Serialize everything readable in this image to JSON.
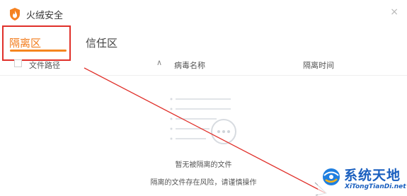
{
  "app": {
    "title": "火绒安全",
    "close_glyph": "×"
  },
  "tabs": [
    {
      "label": "隔离区",
      "active": true
    },
    {
      "label": "信任区",
      "active": false
    }
  ],
  "table": {
    "columns": {
      "path": "文件路径",
      "virus_name": "病毒名称",
      "time": "隔离时间"
    },
    "sort_glyph": "∧"
  },
  "empty_state": {
    "title": "暂无被隔离的文件",
    "hint": "隔离的文件存在风险，请谨慎操作"
  },
  "watermark": {
    "cn": "系统天地",
    "en": "XiTongTianDi.net"
  },
  "colors": {
    "accent": "#f5861f",
    "annotation_red": "#e0302a",
    "watermark_blue": "#1a5fbf"
  }
}
